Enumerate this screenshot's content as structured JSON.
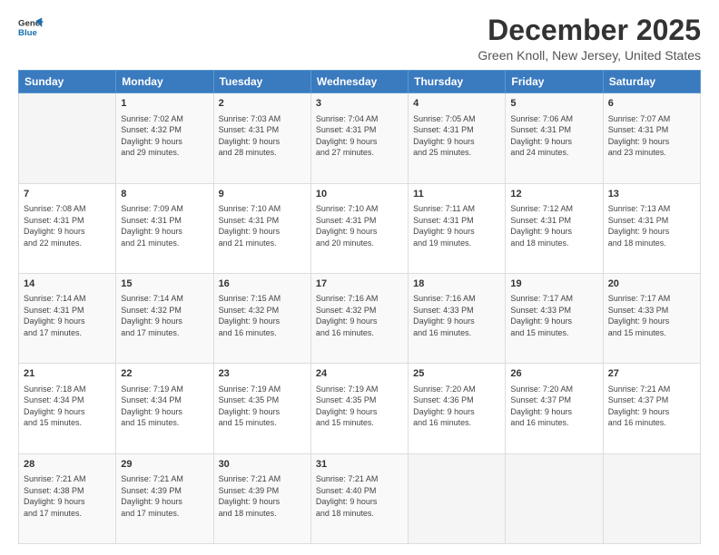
{
  "logo": {
    "line1": "General",
    "line2": "Blue"
  },
  "title": "December 2025",
  "subtitle": "Green Knoll, New Jersey, United States",
  "headers": [
    "Sunday",
    "Monday",
    "Tuesday",
    "Wednesday",
    "Thursday",
    "Friday",
    "Saturday"
  ],
  "weeks": [
    [
      {
        "day": "",
        "info": ""
      },
      {
        "day": "1",
        "info": "Sunrise: 7:02 AM\nSunset: 4:32 PM\nDaylight: 9 hours\nand 29 minutes."
      },
      {
        "day": "2",
        "info": "Sunrise: 7:03 AM\nSunset: 4:31 PM\nDaylight: 9 hours\nand 28 minutes."
      },
      {
        "day": "3",
        "info": "Sunrise: 7:04 AM\nSunset: 4:31 PM\nDaylight: 9 hours\nand 27 minutes."
      },
      {
        "day": "4",
        "info": "Sunrise: 7:05 AM\nSunset: 4:31 PM\nDaylight: 9 hours\nand 25 minutes."
      },
      {
        "day": "5",
        "info": "Sunrise: 7:06 AM\nSunset: 4:31 PM\nDaylight: 9 hours\nand 24 minutes."
      },
      {
        "day": "6",
        "info": "Sunrise: 7:07 AM\nSunset: 4:31 PM\nDaylight: 9 hours\nand 23 minutes."
      }
    ],
    [
      {
        "day": "7",
        "info": "Sunrise: 7:08 AM\nSunset: 4:31 PM\nDaylight: 9 hours\nand 22 minutes."
      },
      {
        "day": "8",
        "info": "Sunrise: 7:09 AM\nSunset: 4:31 PM\nDaylight: 9 hours\nand 21 minutes."
      },
      {
        "day": "9",
        "info": "Sunrise: 7:10 AM\nSunset: 4:31 PM\nDaylight: 9 hours\nand 21 minutes."
      },
      {
        "day": "10",
        "info": "Sunrise: 7:10 AM\nSunset: 4:31 PM\nDaylight: 9 hours\nand 20 minutes."
      },
      {
        "day": "11",
        "info": "Sunrise: 7:11 AM\nSunset: 4:31 PM\nDaylight: 9 hours\nand 19 minutes."
      },
      {
        "day": "12",
        "info": "Sunrise: 7:12 AM\nSunset: 4:31 PM\nDaylight: 9 hours\nand 18 minutes."
      },
      {
        "day": "13",
        "info": "Sunrise: 7:13 AM\nSunset: 4:31 PM\nDaylight: 9 hours\nand 18 minutes."
      }
    ],
    [
      {
        "day": "14",
        "info": "Sunrise: 7:14 AM\nSunset: 4:31 PM\nDaylight: 9 hours\nand 17 minutes."
      },
      {
        "day": "15",
        "info": "Sunrise: 7:14 AM\nSunset: 4:32 PM\nDaylight: 9 hours\nand 17 minutes."
      },
      {
        "day": "16",
        "info": "Sunrise: 7:15 AM\nSunset: 4:32 PM\nDaylight: 9 hours\nand 16 minutes."
      },
      {
        "day": "17",
        "info": "Sunrise: 7:16 AM\nSunset: 4:32 PM\nDaylight: 9 hours\nand 16 minutes."
      },
      {
        "day": "18",
        "info": "Sunrise: 7:16 AM\nSunset: 4:33 PM\nDaylight: 9 hours\nand 16 minutes."
      },
      {
        "day": "19",
        "info": "Sunrise: 7:17 AM\nSunset: 4:33 PM\nDaylight: 9 hours\nand 15 minutes."
      },
      {
        "day": "20",
        "info": "Sunrise: 7:17 AM\nSunset: 4:33 PM\nDaylight: 9 hours\nand 15 minutes."
      }
    ],
    [
      {
        "day": "21",
        "info": "Sunrise: 7:18 AM\nSunset: 4:34 PM\nDaylight: 9 hours\nand 15 minutes."
      },
      {
        "day": "22",
        "info": "Sunrise: 7:19 AM\nSunset: 4:34 PM\nDaylight: 9 hours\nand 15 minutes."
      },
      {
        "day": "23",
        "info": "Sunrise: 7:19 AM\nSunset: 4:35 PM\nDaylight: 9 hours\nand 15 minutes."
      },
      {
        "day": "24",
        "info": "Sunrise: 7:19 AM\nSunset: 4:35 PM\nDaylight: 9 hours\nand 15 minutes."
      },
      {
        "day": "25",
        "info": "Sunrise: 7:20 AM\nSunset: 4:36 PM\nDaylight: 9 hours\nand 16 minutes."
      },
      {
        "day": "26",
        "info": "Sunrise: 7:20 AM\nSunset: 4:37 PM\nDaylight: 9 hours\nand 16 minutes."
      },
      {
        "day": "27",
        "info": "Sunrise: 7:21 AM\nSunset: 4:37 PM\nDaylight: 9 hours\nand 16 minutes."
      }
    ],
    [
      {
        "day": "28",
        "info": "Sunrise: 7:21 AM\nSunset: 4:38 PM\nDaylight: 9 hours\nand 17 minutes."
      },
      {
        "day": "29",
        "info": "Sunrise: 7:21 AM\nSunset: 4:39 PM\nDaylight: 9 hours\nand 17 minutes."
      },
      {
        "day": "30",
        "info": "Sunrise: 7:21 AM\nSunset: 4:39 PM\nDaylight: 9 hours\nand 18 minutes."
      },
      {
        "day": "31",
        "info": "Sunrise: 7:21 AM\nSunset: 4:40 PM\nDaylight: 9 hours\nand 18 minutes."
      },
      {
        "day": "",
        "info": ""
      },
      {
        "day": "",
        "info": ""
      },
      {
        "day": "",
        "info": ""
      }
    ]
  ]
}
